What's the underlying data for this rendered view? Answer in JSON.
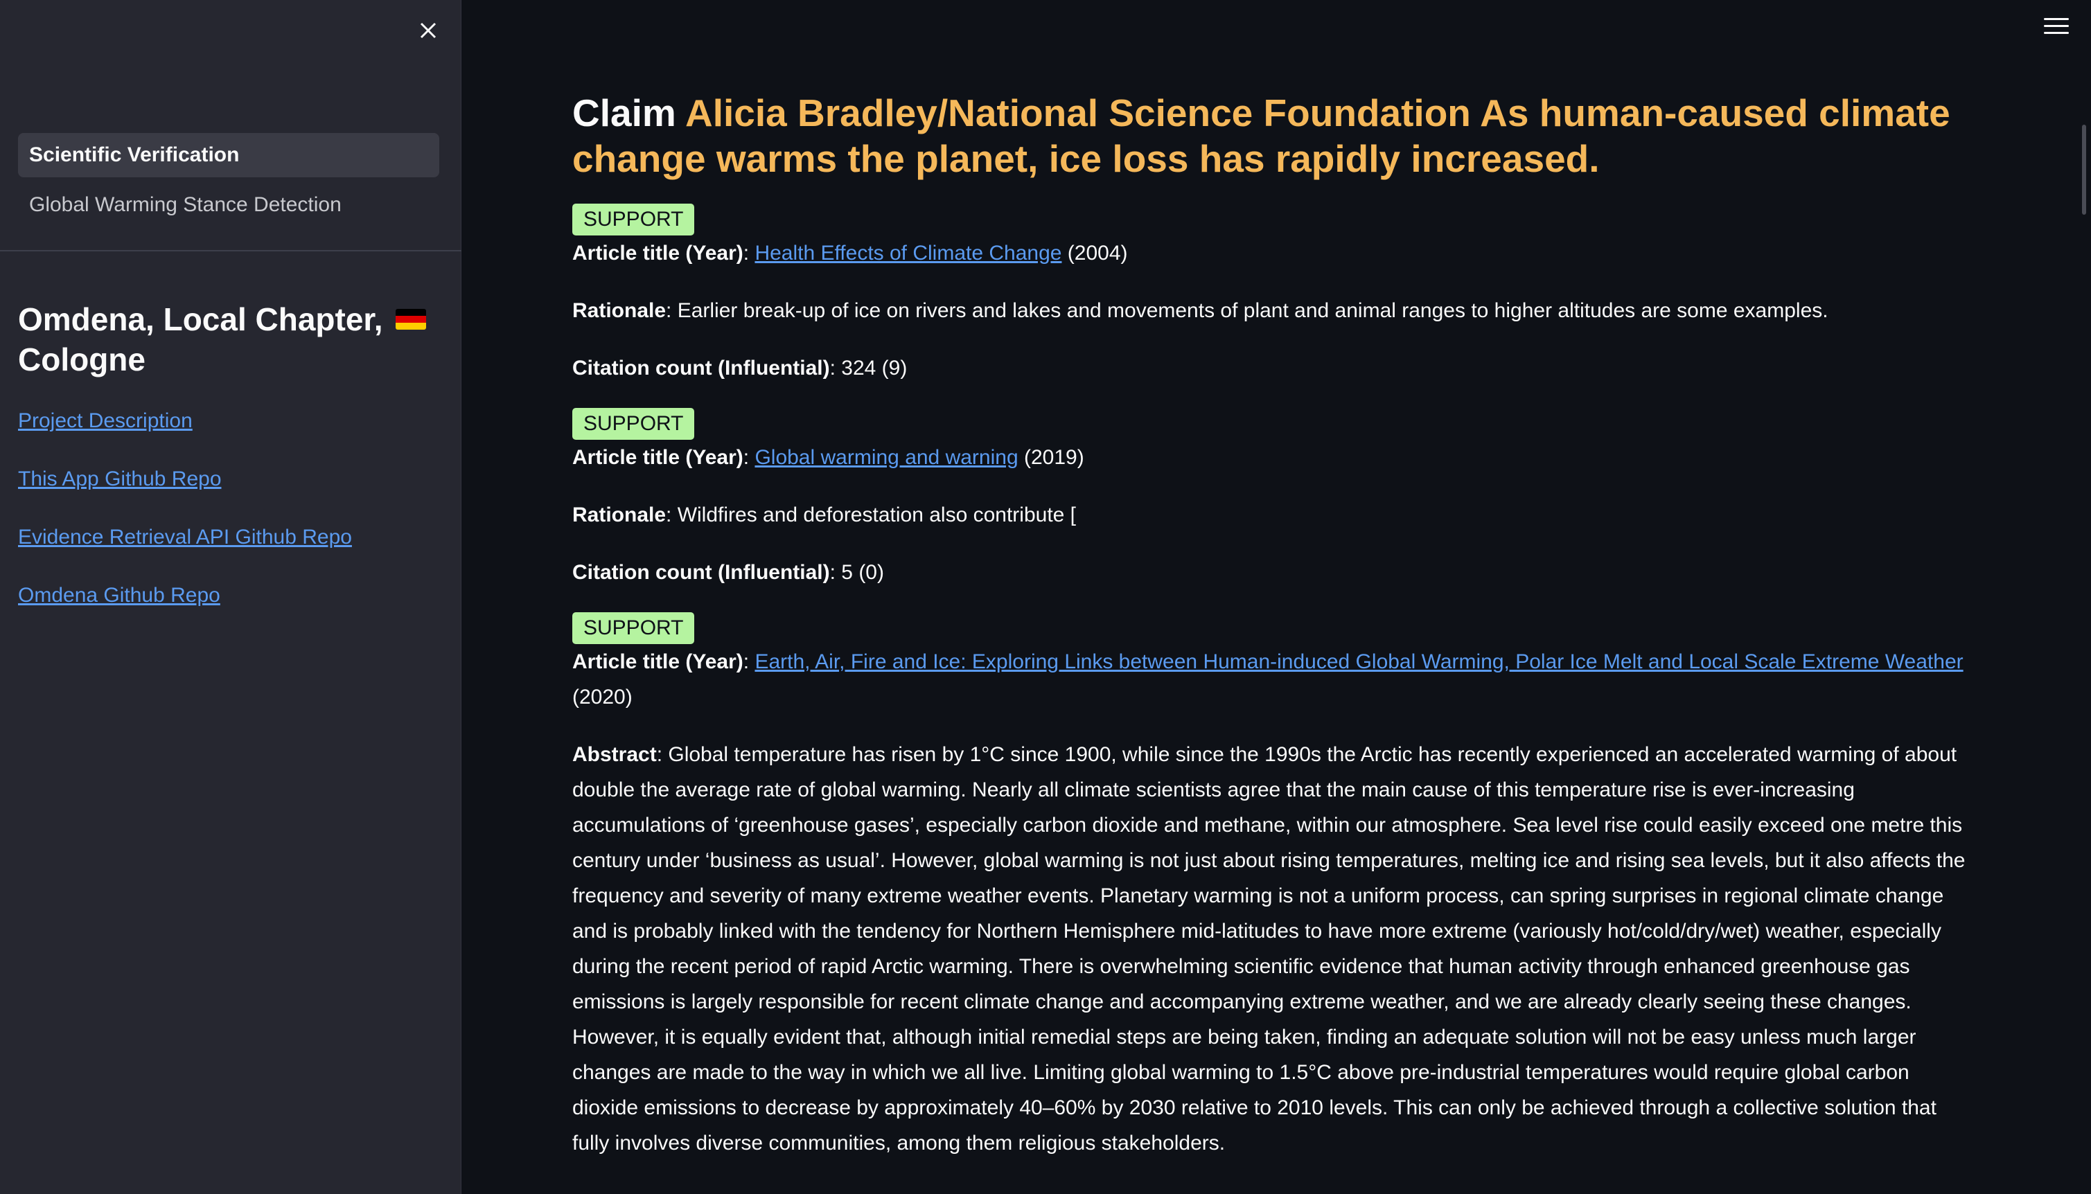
{
  "sidebar": {
    "nav_items": [
      {
        "label": "Scientific Verification",
        "active": true
      },
      {
        "label": "Global Warming Stance Detection",
        "active": false
      }
    ],
    "org_title": "Omdena, Local Chapter,",
    "org_city": "Cologne",
    "flag_icon": "german-flag-icon",
    "links": [
      {
        "label": "Project Description"
      },
      {
        "label": "This App Github Repo"
      },
      {
        "label": "Evidence Retrieval API Github Repo"
      },
      {
        "label": "Omdena Github Repo"
      }
    ]
  },
  "main": {
    "claim_label": "Claim",
    "claim_text": "Alicia Bradley/National Science Foundation As human-caused climate change warms the planet, ice loss has rapidly increased.",
    "labels": {
      "article_title": "Article title (Year)",
      "rationale": "Rationale",
      "citation_count": "Citation count (Influential)",
      "abstract": "Abstract"
    },
    "evidence": [
      {
        "stance": "SUPPORT",
        "title": "Health Effects of Climate Change",
        "year": "(2004)",
        "rationale": "Earlier break-up of ice on rivers and lakes and movements of plant and animal ranges to higher altitudes are some examples.",
        "citations": "324 (9)"
      },
      {
        "stance": "SUPPORT",
        "title": "Global warming and warning",
        "year": "(2019)",
        "rationale": "Wildfires and deforestation also contribute [",
        "citations": "5 (0)"
      },
      {
        "stance": "SUPPORT",
        "title": "Earth, Air, Fire and Ice: Exploring Links between Human-induced Global Warming, Polar Ice Melt and Local Scale Extreme Weather",
        "year": "(2020)",
        "abstract": "Global temperature has risen by 1°C since 1900, while since the 1990s the Arctic has recently experienced an accelerated warming of about double the average rate of global warming. Nearly all climate scientists agree that the main cause of this temperature rise is ever-increasing accumulations of ‘greenhouse gases’, especially carbon dioxide and methane, within our atmosphere. Sea level rise could easily exceed one metre this century under ‘business as usual’. However, global warming is not just about rising temperatures, melting ice and rising sea levels, but it also affects the frequency and severity of many extreme weather events. Planetary warming is not a uniform process, can spring surprises in regional climate change and is probably linked with the tendency for Northern Hemisphere mid-latitudes to have more extreme (variously hot/cold/dry/wet) weather, especially during the recent period of rapid Arctic warming. There is overwhelming scientific evidence that human activity through enhanced greenhouse gas emissions is largely responsible for recent climate change and accompanying extreme weather, and we are already clearly seeing these changes. However, it is equally evident that, although initial remedial steps are being taken, finding an adequate solution will not be easy unless much larger changes are made to the way in which we all live. Limiting global warming to 1.5°C above pre-industrial temperatures would require global carbon dioxide emissions to decrease by approximately 40–60% by 2030 relative to 2010 levels. This can only be achieved through a collective solution that fully involves diverse communities, among them religious stakeholders."
      }
    ]
  },
  "colors": {
    "background": "#0e1117",
    "sidebar": "#262730",
    "claim_accent": "#f5b85a",
    "support_badge": "#b5f3a0",
    "link": "#5b9bf0"
  }
}
